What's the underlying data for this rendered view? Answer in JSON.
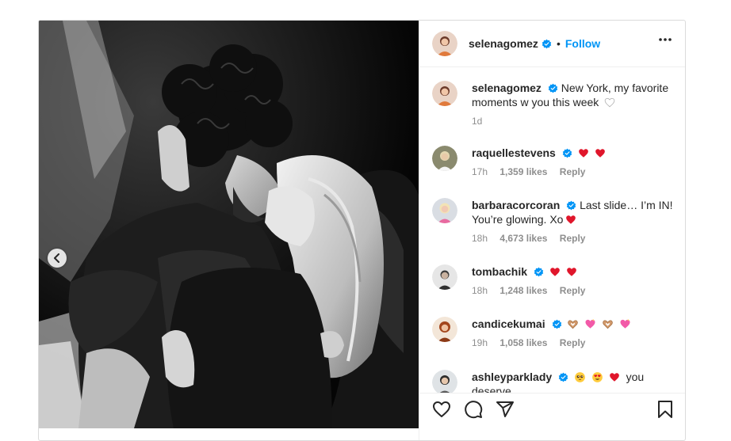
{
  "post": {
    "author": "selenagomez",
    "dot": "•",
    "follow_label": "Follow",
    "caption": "New York, my favorite moments w you this week",
    "time": "1d"
  },
  "comments": [
    {
      "user": "raquellestevens",
      "text": "",
      "time": "17h",
      "likes": "1,359 likes",
      "reply": "Reply"
    },
    {
      "user": "barbaracorcoran",
      "text": "Last slide… I’m IN! You’re glowing. Xo",
      "time": "18h",
      "likes": "4,673 likes",
      "reply": "Reply"
    },
    {
      "user": "tombachik",
      "text": "",
      "time": "18h",
      "likes": "1,248 likes",
      "reply": "Reply"
    },
    {
      "user": "candicekumai",
      "text": "",
      "time": "19h",
      "likes": "1,058 likes",
      "reply": "Reply"
    },
    {
      "user": "ashleyparklady",
      "text": "you deserve"
    }
  ],
  "icons": {
    "verified": "verified-badge-icon",
    "more": "more-options-icon",
    "like": "heart-outline-icon",
    "comment": "comment-bubble-icon",
    "share": "paper-plane-icon",
    "save": "bookmark-icon",
    "prev": "chevron-left-icon"
  },
  "colors": {
    "accent": "#0095f6",
    "heart": "#ed4956",
    "muted": "#8e8e8e",
    "text": "#262626"
  }
}
